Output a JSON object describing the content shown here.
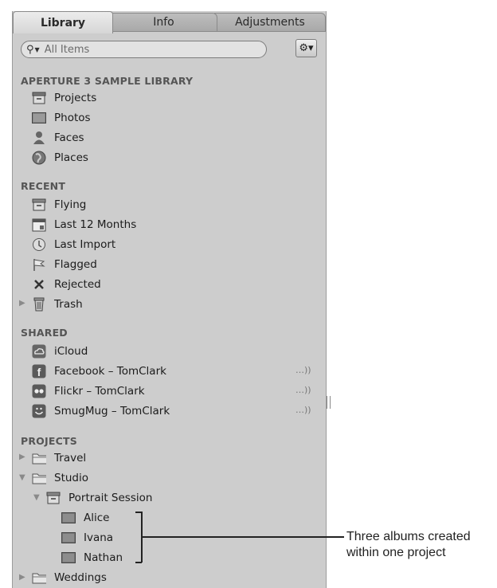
{
  "tabs": [
    {
      "label": "Library"
    },
    {
      "label": "Info"
    },
    {
      "label": "Adjustments"
    }
  ],
  "search": {
    "placeholder": "All Items"
  },
  "sections": {
    "library": {
      "header": "APERTURE 3 SAMPLE LIBRARY",
      "items": [
        {
          "label": "Projects",
          "icon": "projects-icon"
        },
        {
          "label": "Photos",
          "icon": "photos-icon"
        },
        {
          "label": "Faces",
          "icon": "faces-icon"
        },
        {
          "label": "Places",
          "icon": "places-icon"
        }
      ]
    },
    "recent": {
      "header": "RECENT",
      "items": [
        {
          "label": "Flying",
          "icon": "project-icon"
        },
        {
          "label": "Last 12 Months",
          "icon": "calendar-icon"
        },
        {
          "label": "Last Import",
          "icon": "import-icon"
        },
        {
          "label": "Flagged",
          "icon": "flag-icon"
        },
        {
          "label": "Rejected",
          "icon": "x-icon"
        },
        {
          "label": "Trash",
          "icon": "trash-icon"
        }
      ]
    },
    "shared": {
      "header": "SHARED",
      "items": [
        {
          "label": "iCloud",
          "icon": "icloud-icon"
        },
        {
          "label": "Facebook – TomClark",
          "icon": "facebook-icon"
        },
        {
          "label": "Flickr – TomClark",
          "icon": "flickr-icon"
        },
        {
          "label": "SmugMug – TomClark",
          "icon": "smugmug-icon"
        }
      ]
    },
    "projects": {
      "header": "PROJECTS",
      "items": [
        {
          "label": "Travel",
          "icon": "folder-icon"
        },
        {
          "label": "Studio",
          "icon": "folder-icon"
        },
        {
          "label": "Portrait Session",
          "icon": "project-icon"
        },
        {
          "label": "Alice",
          "icon": "album-icon"
        },
        {
          "label": "Ivana",
          "icon": "album-icon"
        },
        {
          "label": "Nathan",
          "icon": "album-icon"
        },
        {
          "label": "Weddings",
          "icon": "folder-icon"
        }
      ]
    }
  },
  "annotation": {
    "line1": "Three albums created",
    "line2": "within one project"
  }
}
